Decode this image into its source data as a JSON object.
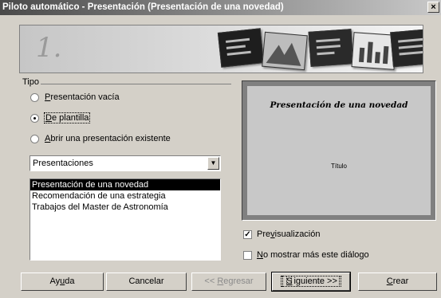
{
  "window": {
    "title": "Piloto automático - Presentación (Presentación de una novedad)",
    "close": "×"
  },
  "banner": {
    "step": "1."
  },
  "tipo": {
    "label": "Tipo",
    "options": [
      {
        "pre": "",
        "u": "P",
        "post": "resentación vacía",
        "checked": false
      },
      {
        "pre": "",
        "u": "D",
        "post": "e plantilla",
        "checked": true
      },
      {
        "pre": "",
        "u": "A",
        "post": "brir una presentación existente",
        "checked": false
      }
    ]
  },
  "category": {
    "value": "Presentaciones",
    "arrow": "▼"
  },
  "templates": [
    "Presentación de una novedad",
    "Recomendación de una estrategia",
    "Trabajos del Master de Astronomía"
  ],
  "preview": {
    "title": "Presentación de una novedad",
    "subtitle": "Título"
  },
  "checks": {
    "preview": {
      "pre": "Pre",
      "u": "v",
      "post": "isualización",
      "checked": true
    },
    "nomore": {
      "pre": "",
      "u": "N",
      "post": "o mostrar más este diálogo",
      "checked": false
    }
  },
  "buttons": {
    "help": {
      "pre": "Ay",
      "u": "u",
      "post": "da"
    },
    "cancel": {
      "pre": "Cancelar",
      "u": "",
      "post": ""
    },
    "back": {
      "pre": "<< ",
      "u": "R",
      "post": "egresar"
    },
    "next": {
      "pre": "",
      "u": "S",
      "post": "iguiente >>"
    },
    "create": {
      "pre": "",
      "u": "C",
      "post": "rear"
    }
  }
}
